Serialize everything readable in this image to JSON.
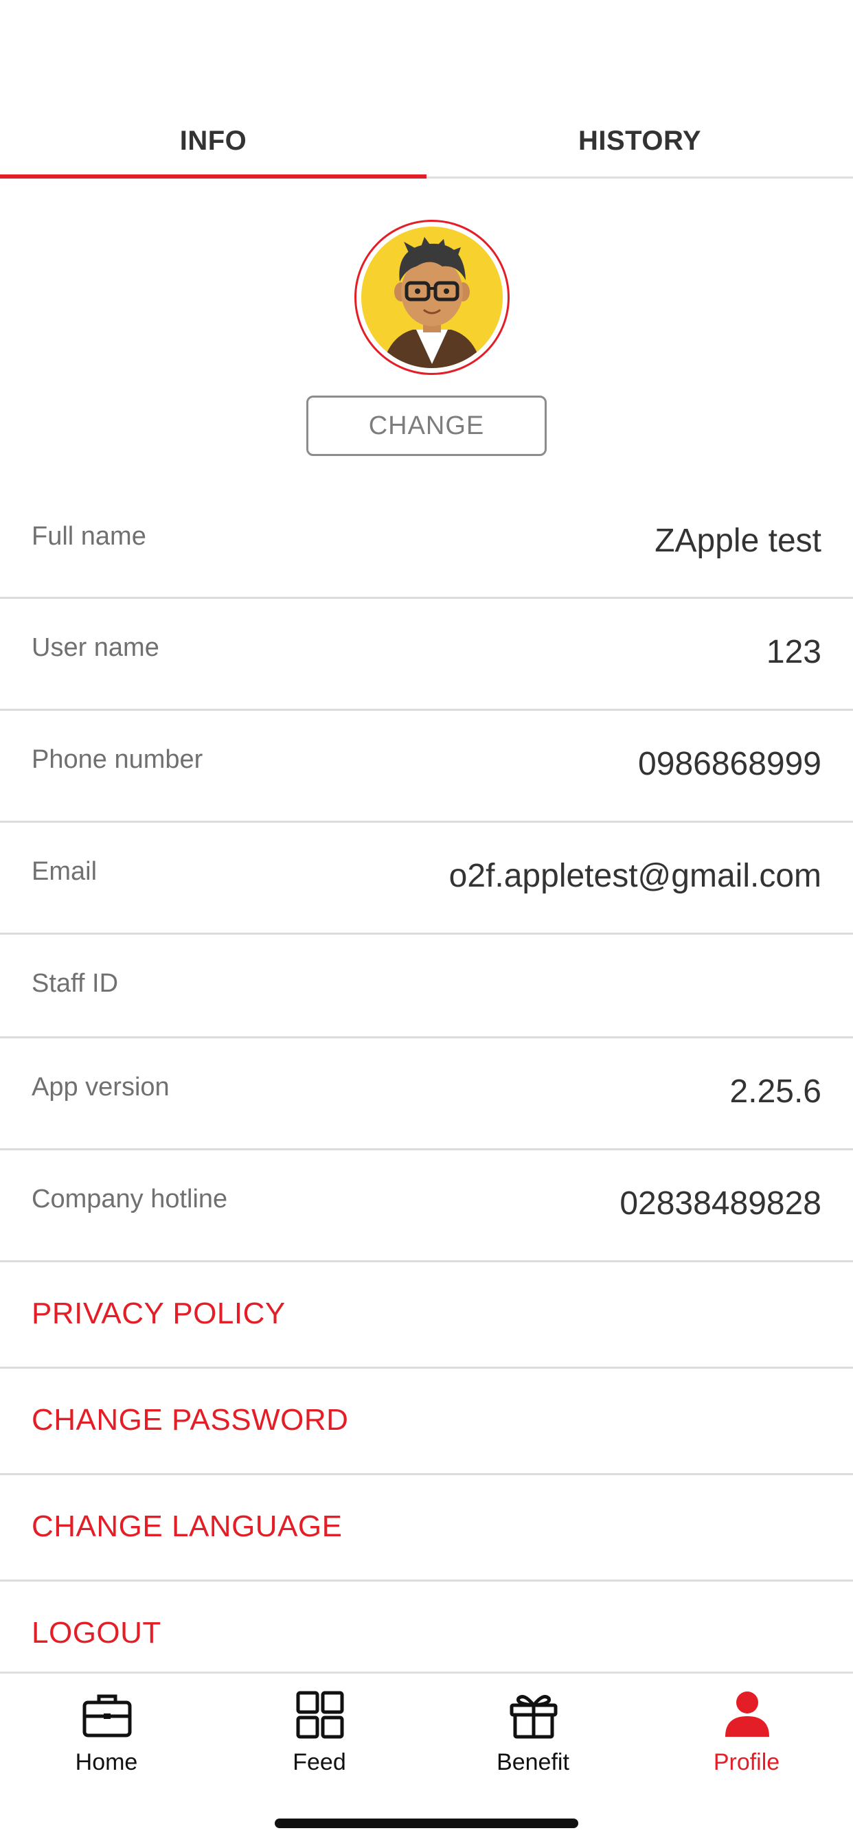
{
  "tabs": [
    {
      "label": "INFO",
      "active": true
    },
    {
      "label": "HISTORY",
      "active": false
    }
  ],
  "profile": {
    "avatar_icon": "user-avatar-icon",
    "change_label": "CHANGE"
  },
  "info_rows": [
    {
      "label": "Full name",
      "value": "ZApple test"
    },
    {
      "label": "User name",
      "value": "123"
    },
    {
      "label": "Phone number",
      "value": "0986868999"
    },
    {
      "label": "Email",
      "value": "o2f.appletest@gmail.com"
    },
    {
      "label": "Staff ID",
      "value": ""
    },
    {
      "label": "App version",
      "value": "2.25.6"
    },
    {
      "label": "Company hotline",
      "value": "02838489828"
    }
  ],
  "actions": [
    {
      "label": "PRIVACY POLICY"
    },
    {
      "label": "CHANGE PASSWORD"
    },
    {
      "label": "CHANGE LANGUAGE"
    },
    {
      "label": "LOGOUT"
    }
  ],
  "bottom_nav": [
    {
      "label": "Home",
      "icon": "briefcase-icon",
      "active": false
    },
    {
      "label": "Feed",
      "icon": "grid-icon",
      "active": false
    },
    {
      "label": "Benefit",
      "icon": "gift-icon",
      "active": false
    },
    {
      "label": "Profile",
      "icon": "person-icon",
      "active": true
    }
  ],
  "colors": {
    "accent": "#e41e26",
    "text": "#333333",
    "muted": "#707070",
    "divider": "#dcdcdc",
    "avatar_bg": "#f7d12e"
  }
}
